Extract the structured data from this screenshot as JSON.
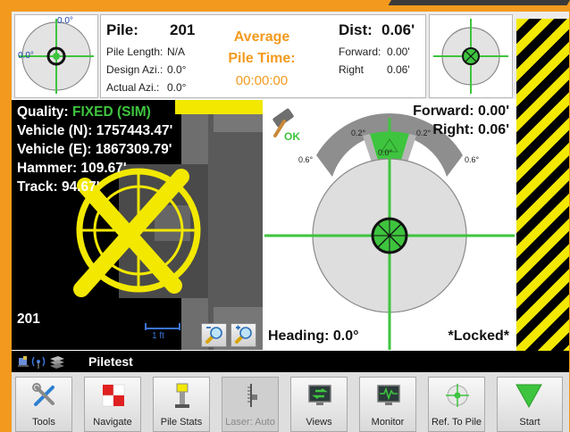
{
  "header": {
    "left_compass": {
      "top_label": "0.0°",
      "left_label": "0.0°"
    },
    "pile_label": "Pile:",
    "pile_value": "201",
    "pile_length_label": "Pile Length:",
    "pile_length_value": "N/A",
    "design_azi_label": "Design Azi.:",
    "design_azi_value": "0.0°",
    "actual_azi_label": "Actual Azi.:",
    "actual_azi_value": "0.0°",
    "avg_title_line1": "Average",
    "avg_title_line2": "Pile Time:",
    "avg_value": "00:00:00",
    "dist_label": "Dist:",
    "dist_value": "0.06'",
    "forward_label": "Forward:",
    "forward_value": "0.00'",
    "right_label": "Right",
    "right_value": "0.06'"
  },
  "vehicle_view": {
    "quality_label": "Quality:",
    "quality_value": "FIXED (SIM)",
    "north_line": "Vehicle (N): 1757443.47'",
    "east_line": "Vehicle (E): 1867309.79'",
    "hammer_line": "Hammer: 109.67'",
    "track_line": "Track: 94.67'",
    "pile_id": "201",
    "scale_label": "1 ft",
    "zoom_out_icon": "zoom-out-icon",
    "zoom_in_icon": "zoom-in-icon"
  },
  "target_view": {
    "forward_text": "Forward: 0.00'",
    "right_text": "Right: 0.06'",
    "ok_label": "OK",
    "arc_labels": [
      "0.6°",
      "0.2°",
      "0.0°",
      "0.2°",
      "0.6°"
    ],
    "heading_text": "Heading: 0.0°",
    "locked_text": "*Locked*"
  },
  "status_bar": {
    "project_name": "Piletest",
    "icons": [
      "gnss-icon",
      "radio-signal-icon",
      "layers-icon"
    ]
  },
  "toolbar": [
    {
      "label": "Tools",
      "icon": "tools-icon",
      "enabled": true
    },
    {
      "label": "Navigate",
      "icon": "checkered-flag-icon",
      "enabled": true
    },
    {
      "label": "Pile Stats",
      "icon": "pile-stats-icon",
      "enabled": true
    },
    {
      "label": "Laser: Auto",
      "icon": "laser-icon",
      "enabled": false
    },
    {
      "label": "Views",
      "icon": "views-icon",
      "enabled": true
    },
    {
      "label": "Monitor",
      "icon": "monitor-icon",
      "enabled": true
    },
    {
      "label": "Ref. To Pile",
      "icon": "crosshair-icon",
      "enabled": true
    },
    {
      "label": "Start",
      "icon": "start-arrow-icon",
      "enabled": true
    }
  ],
  "colors": {
    "frame": "#f39a1e",
    "accent_green": "#3ec43e",
    "yellow": "#f2e800",
    "text_orange": "#f39a1e"
  }
}
